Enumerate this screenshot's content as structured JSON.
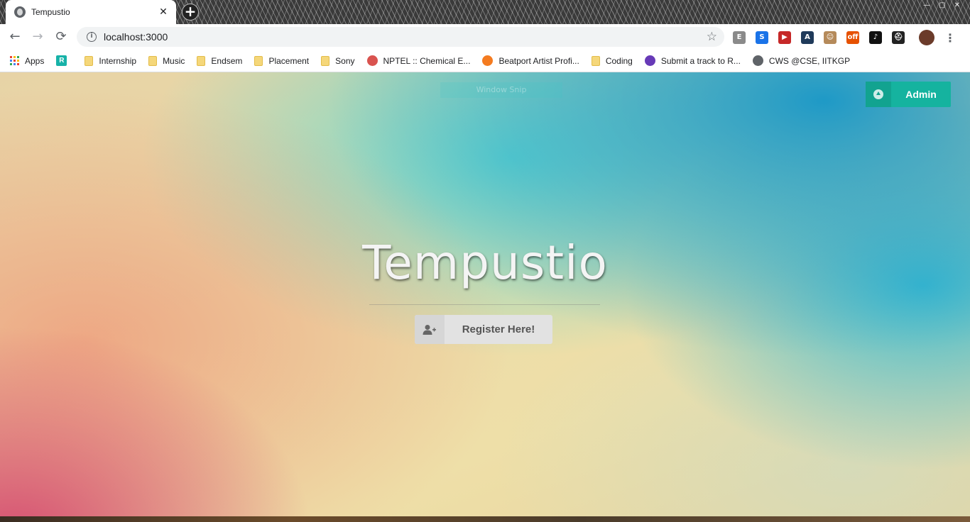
{
  "browser": {
    "tab_title": "Tempustio",
    "tab_close": "✕",
    "new_tab": "+",
    "url": "localhost:3000",
    "nav": {
      "back": "←",
      "forward": "→",
      "reload": "⟳"
    },
    "extensions": [
      {
        "name": "E",
        "color": "#8a8a8a"
      },
      {
        "name": "S",
        "color": "#1a73e8"
      },
      {
        "name": "▶",
        "color": "#c62828"
      },
      {
        "name": "A",
        "color": "#1f3a5a"
      },
      {
        "name": "☺",
        "color": "#b58a5a"
      },
      {
        "name": "off",
        "color": "#e65100"
      },
      {
        "name": "♪",
        "color": "#111111"
      },
      {
        "name": "⛑",
        "color": "#222222"
      }
    ]
  },
  "bookmarks": [
    {
      "label": "Apps",
      "type": "apps"
    },
    {
      "label": "",
      "type": "rb",
      "icon": "R",
      "color": "#17b2a8"
    },
    {
      "label": "Internship",
      "type": "folder"
    },
    {
      "label": "Music",
      "type": "folder"
    },
    {
      "label": "Endsem",
      "type": "folder"
    },
    {
      "label": "Placement",
      "type": "folder"
    },
    {
      "label": "Sony",
      "type": "folder"
    },
    {
      "label": "NPTEL :: Chemical E...",
      "type": "site",
      "color": "#d9534f"
    },
    {
      "label": "Beatport Artist Profi...",
      "type": "site",
      "color": "#f47b20"
    },
    {
      "label": "Coding",
      "type": "folder"
    },
    {
      "label": "Submit a track to R...",
      "type": "site",
      "color": "#673ab7"
    },
    {
      "label": "CWS @CSE, IITKGP",
      "type": "site",
      "color": "#5f6368"
    }
  ],
  "page": {
    "ghost_label": "Window Snip",
    "admin_button": "Admin",
    "hero_title": "Tempustio",
    "register_button": "Register Here!"
  }
}
